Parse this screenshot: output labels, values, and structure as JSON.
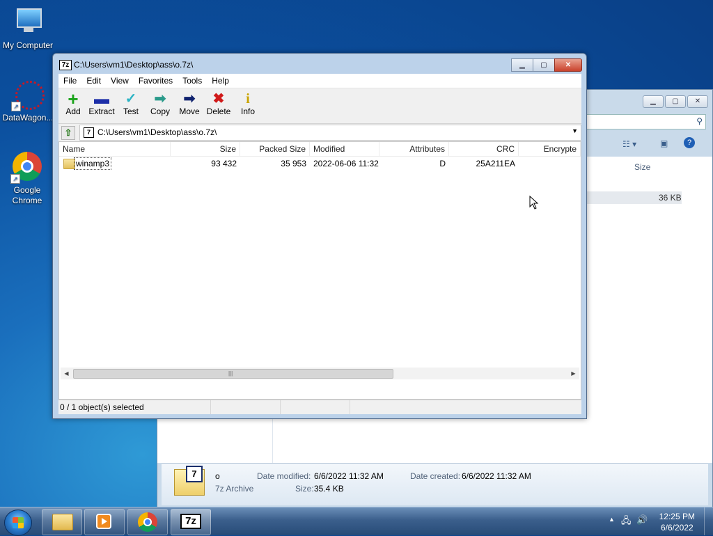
{
  "desktop": {
    "icons": [
      {
        "label": "My Computer"
      },
      {
        "label": "DataWagon..."
      },
      {
        "label": "Google Chrome"
      }
    ]
  },
  "explorer": {
    "column_size": "Size",
    "row_size": "36 KB",
    "details": {
      "name": "o",
      "type": "7z Archive",
      "date_modified_label": "Date modified:",
      "date_modified": "6/6/2022 11:32 AM",
      "date_created_label": "Date created:",
      "date_created": "6/6/2022 11:32 AM",
      "size_label": "Size:",
      "size": "35.4 KB"
    }
  },
  "zip": {
    "title": "C:\\Users\\vm1\\Desktop\\ass\\o.7z\\",
    "app_icon_text": "7z",
    "menu": [
      "File",
      "Edit",
      "View",
      "Favorites",
      "Tools",
      "Help"
    ],
    "toolbar": [
      {
        "label": "Add",
        "icon": "plus-icon",
        "color": "#1aa31a",
        "glyph": "+"
      },
      {
        "label": "Extract",
        "icon": "minus-icon",
        "color": "#1c2ea8",
        "glyph": "—"
      },
      {
        "label": "Test",
        "icon": "check-icon",
        "color": "#2db4c4",
        "glyph": "✓"
      },
      {
        "label": "Copy",
        "icon": "copy-arrow-icon",
        "color": "#2a9a8a",
        "glyph": "➡"
      },
      {
        "label": "Move",
        "icon": "move-arrow-icon",
        "color": "#10226e",
        "glyph": "➡"
      },
      {
        "label": "Delete",
        "icon": "delete-x-icon",
        "color": "#d01a1a",
        "glyph": "✖"
      },
      {
        "label": "Info",
        "icon": "info-icon",
        "color": "#c9a400",
        "glyph": "i"
      }
    ],
    "address": "C:\\Users\\vm1\\Desktop\\ass\\o.7z\\",
    "columns": [
      "Name",
      "Size",
      "Packed Size",
      "Modified",
      "Attributes",
      "CRC",
      "Encrypte"
    ],
    "rows": [
      {
        "name": "winamp3",
        "size": "93 432",
        "packed": "35 953",
        "modified": "2022-06-06 11:32",
        "attributes": "D",
        "crc": "25A211EA",
        "encrypted": ""
      }
    ],
    "status": "0 / 1 object(s) selected"
  },
  "taskbar": {
    "time": "12:25 PM",
    "date": "6/6/2022"
  }
}
